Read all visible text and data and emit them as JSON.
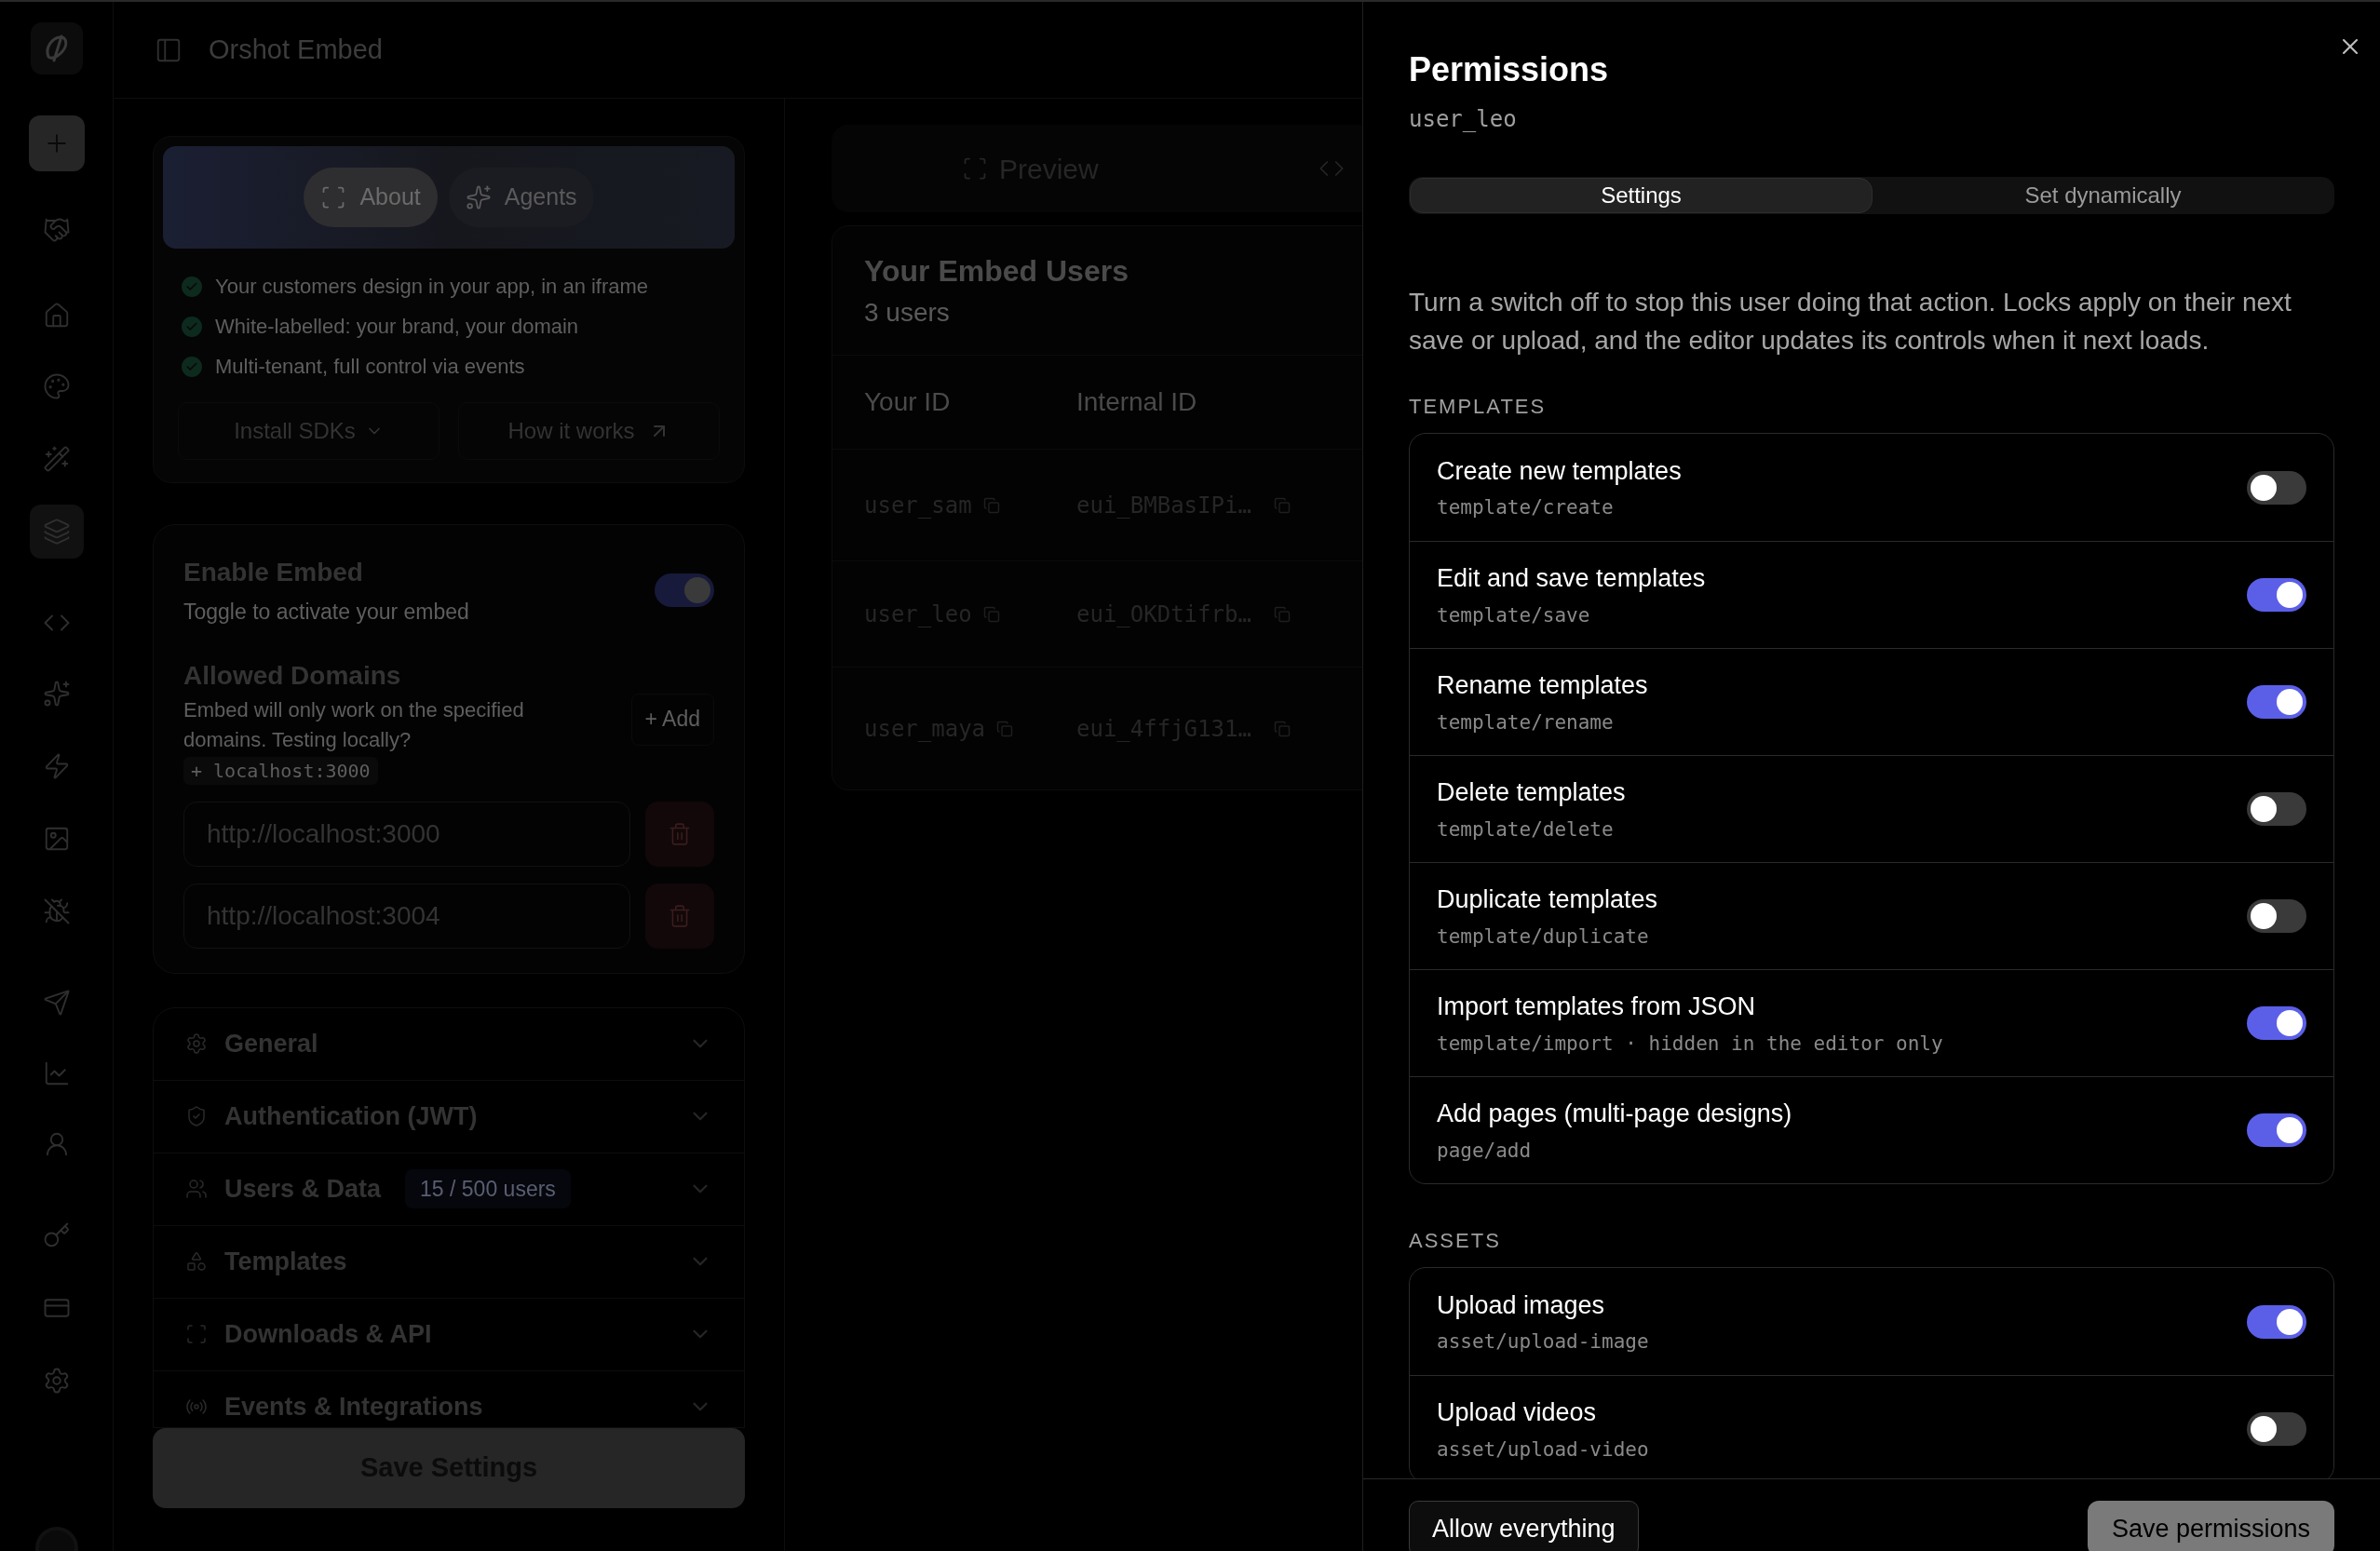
{
  "sidebar": {
    "items": [
      {
        "kind": "plus",
        "selected": false
      },
      {
        "kind": "handshake",
        "selected": false
      },
      {
        "kind": "home",
        "selected": false
      },
      {
        "kind": "palette",
        "selected": false
      },
      {
        "kind": "wand",
        "selected": false
      },
      {
        "kind": "layers",
        "selected": true
      },
      {
        "kind": "code",
        "selected": false
      },
      {
        "kind": "sparkles",
        "selected": false
      },
      {
        "kind": "zap",
        "selected": false
      },
      {
        "kind": "image",
        "selected": false
      },
      {
        "kind": "bug",
        "selected": false
      },
      {
        "kind": "send",
        "selected": false
      },
      {
        "kind": "chart",
        "selected": false
      },
      {
        "kind": "users",
        "selected": false
      },
      {
        "kind": "key",
        "selected": false
      },
      {
        "kind": "card",
        "selected": false
      },
      {
        "kind": "settings",
        "selected": false
      }
    ]
  },
  "header": {
    "title": "Orshot Embed"
  },
  "about_card": {
    "tabs": [
      {
        "label": "About",
        "selected": true
      },
      {
        "label": "Agents",
        "selected": false
      }
    ],
    "features": [
      "Your customers design in your app, in an iframe",
      "White-labelled: your brand, your domain",
      "Multi-tenant, full control via events"
    ],
    "install_link": "Install SDKs",
    "how_link": "How it works"
  },
  "embed_settings": {
    "title": "Enable Embed",
    "subtitle": "Toggle to activate your embed",
    "on": true
  },
  "allowed_domains": {
    "title": "Allowed Domains",
    "description": "Embed will only work on the specified domains. Testing locally?",
    "hint": "+ localhost:3000",
    "add_button": "+ Add",
    "domains": [
      "http://localhost:3000",
      "http://localhost:3004"
    ]
  },
  "sections": [
    {
      "kind": "general",
      "label": "General"
    },
    {
      "kind": "auth",
      "label": "Authentication (JWT)"
    },
    {
      "kind": "users",
      "label": "Users & Data",
      "badge": "15 / 500 users"
    },
    {
      "kind": "templates",
      "label": "Templates"
    },
    {
      "kind": "downloads",
      "label": "Downloads & API"
    },
    {
      "kind": "events",
      "label": "Events & Integrations"
    }
  ],
  "save_button": "Save Settings",
  "middle": {
    "tabs": [
      {
        "label": "Preview",
        "kind": "preview"
      },
      {
        "kind": "code"
      }
    ],
    "users_card": {
      "title": "Your Embed Users",
      "count": "3 users",
      "columns": [
        "Your ID",
        "Internal ID"
      ],
      "rows": [
        {
          "your_id": "user_sam",
          "internal_id": "eui_BMBasIPi…"
        },
        {
          "your_id": "user_leo",
          "internal_id": "eui_OKDtifrb…"
        },
        {
          "your_id": "user_maya",
          "internal_id": "eui_4ffjG131…"
        }
      ]
    }
  },
  "drawer": {
    "title": "Permissions",
    "subtitle": "user_leo",
    "tabs": [
      {
        "label": "Settings",
        "selected": true
      },
      {
        "label": "Set dynamically",
        "selected": false
      }
    ],
    "description": "Turn a switch off to stop this user doing that action. Locks apply on their next save or upload, and the editor updates its controls when it next loads.",
    "groups": [
      {
        "label": "TEMPLATES",
        "permissions": [
          {
            "title": "Create new templates",
            "code": "template/create",
            "on": false
          },
          {
            "title": "Edit and save templates",
            "code": "template/save",
            "on": true
          },
          {
            "title": "Rename templates",
            "code": "template/rename",
            "on": true
          },
          {
            "title": "Delete templates",
            "code": "template/delete",
            "on": false
          },
          {
            "title": "Duplicate templates",
            "code": "template/duplicate",
            "on": false
          },
          {
            "title": "Import templates from JSON",
            "code": "template/import · hidden in the editor only",
            "on": true
          },
          {
            "title": "Add pages (multi-page designs)",
            "code": "page/add",
            "on": true
          }
        ]
      },
      {
        "label": "ASSETS",
        "permissions": [
          {
            "title": "Upload images",
            "code": "asset/upload-image",
            "on": true
          },
          {
            "title": "Upload videos",
            "code": "asset/upload-video",
            "on": false
          }
        ]
      }
    ],
    "allow_button": "Allow everything",
    "save_button": "Save permissions"
  }
}
